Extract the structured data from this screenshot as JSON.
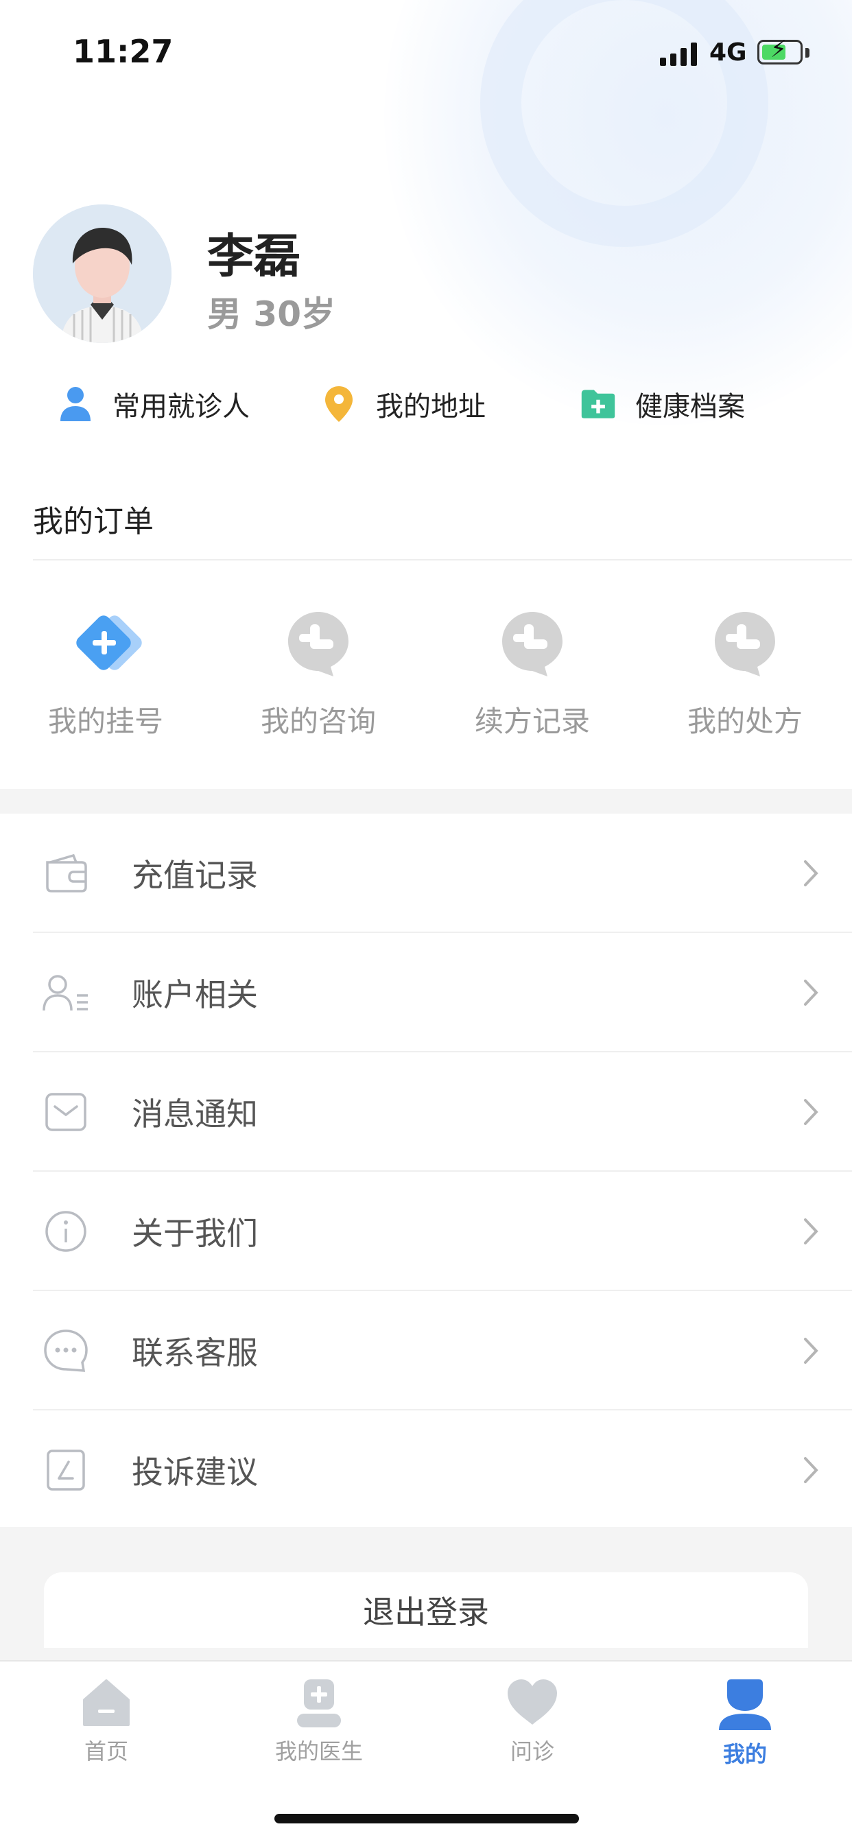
{
  "status_bar": {
    "time": "11:27",
    "network": "4G"
  },
  "profile": {
    "name": "李磊",
    "info": "男 30岁"
  },
  "quick_links": [
    {
      "label": "常用就诊人",
      "icon": "person-icon"
    },
    {
      "label": "我的地址",
      "icon": "location-pin-icon"
    },
    {
      "label": "健康档案",
      "icon": "health-folder-icon"
    }
  ],
  "orders": {
    "title": "我的订单",
    "items": [
      {
        "label": "我的挂号",
        "icon": "registration-icon",
        "active": true
      },
      {
        "label": "我的咨询",
        "icon": "consult-icon",
        "active": false
      },
      {
        "label": "续方记录",
        "icon": "renewal-icon",
        "active": false
      },
      {
        "label": "我的处方",
        "icon": "prescription-icon",
        "active": false
      }
    ]
  },
  "menu": [
    {
      "label": "充值记录",
      "icon": "wallet-icon"
    },
    {
      "label": "账户相关",
      "icon": "account-icon"
    },
    {
      "label": "消息通知",
      "icon": "message-icon"
    },
    {
      "label": "关于我们",
      "icon": "info-icon"
    },
    {
      "label": "联系客服",
      "icon": "chat-icon"
    },
    {
      "label": "投诉建议",
      "icon": "edit-icon"
    }
  ],
  "logout_label": "退出登录",
  "tabs": [
    {
      "label": "首页",
      "icon": "home-icon",
      "active": false
    },
    {
      "label": "我的医生",
      "icon": "doctor-icon",
      "active": false
    },
    {
      "label": "问诊",
      "icon": "heart-icon",
      "active": false
    },
    {
      "label": "我的",
      "icon": "user-icon",
      "active": true
    }
  ],
  "colors": {
    "accent": "#3c7ee0",
    "inactive": "#c8ccd2",
    "text_muted": "#9a9a9a"
  }
}
